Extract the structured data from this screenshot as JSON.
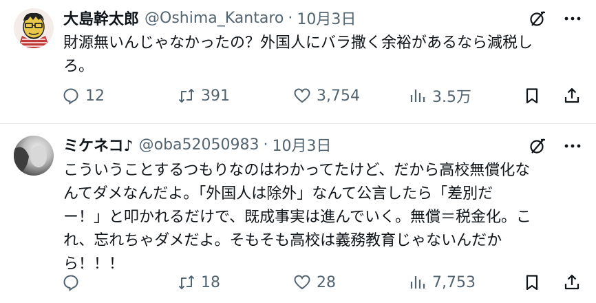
{
  "tweets": [
    {
      "display_name": "大島幹太郎",
      "handle": "@Oshima_Kantaro",
      "separator": "·",
      "date": "10月3日",
      "text": "財源無いんじゃなかったの？外国人にバラ撒く余裕があるなら減税し\nろ。",
      "replies": "12",
      "retweets": "391",
      "likes": "3,754",
      "views": "3.5万",
      "avatar_icon": "cartoon-face-avatar"
    },
    {
      "display_name": "ミケネコ♪",
      "handle": "@oba52050983",
      "separator": "·",
      "date": "10月3日",
      "text": "こういうことするつもりなのはわかってたけど、だから高校無償化な\nんてダメなんだよ。「外国人は除外」なんて公言したら「差別だ\nー！」と叩かれるだけで、既成事実は進んでいく。無償＝税金化。こ\nれ、忘れちゃダメだよ。そもそも高校は義務教育じゃないんだか\nら！！！",
      "replies": "",
      "retweets": "18",
      "likes": "28",
      "views": "7,753",
      "avatar_icon": "photo-avatar"
    }
  ],
  "icons": {
    "grok": "grok-slash-circle-icon",
    "more": "more-dots-icon",
    "reply": "reply-icon",
    "retweet": "retweet-icon",
    "like": "heart-icon",
    "views": "views-bar-chart-icon",
    "bookmark": "bookmark-icon",
    "share": "share-icon"
  },
  "colors": {
    "text": "#0f1419",
    "secondary": "#536471",
    "divider": "#e6e9ec"
  }
}
